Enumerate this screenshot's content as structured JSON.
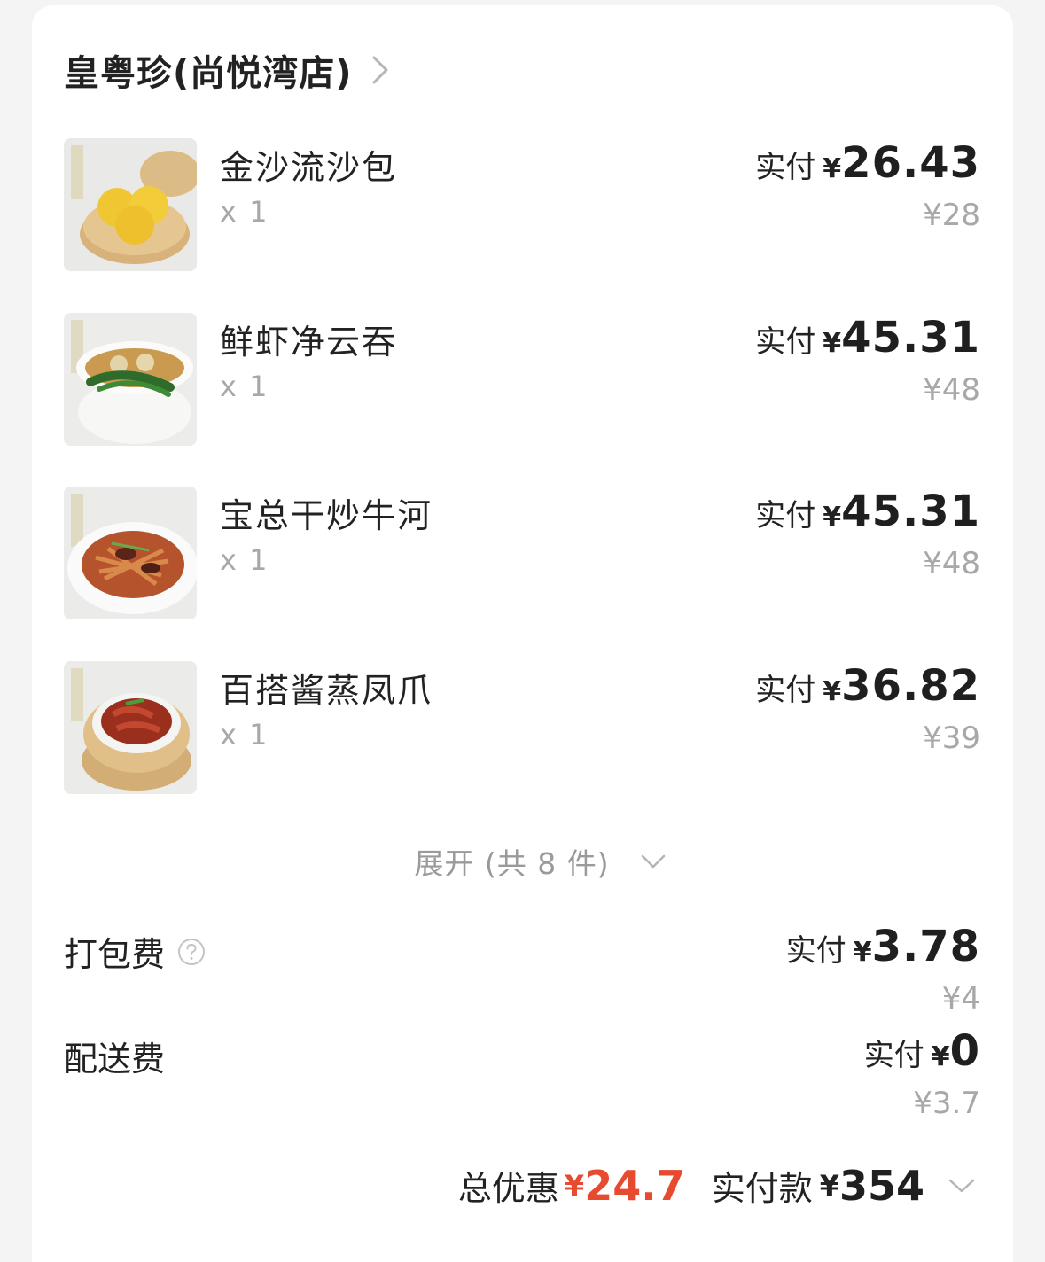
{
  "store": {
    "name": "皇粤珍(尚悦湾店)"
  },
  "items": [
    {
      "name": "金沙流沙包",
      "qty": "x 1",
      "paid_label": "实付",
      "currency": "¥",
      "paid": "26.43",
      "original": "¥28",
      "image": "steamed-custard-buns"
    },
    {
      "name": "鲜虾净云吞",
      "qty": "x 1",
      "paid_label": "实付",
      "currency": "¥",
      "paid": "45.31",
      "original": "¥48",
      "image": "shrimp-wonton-soup"
    },
    {
      "name": "宝总干炒牛河",
      "qty": "x 1",
      "paid_label": "实付",
      "currency": "¥",
      "paid": "45.31",
      "original": "¥48",
      "image": "beef-chow-fun"
    },
    {
      "name": "百搭酱蒸凤爪",
      "qty": "x 1",
      "paid_label": "实付",
      "currency": "¥",
      "paid": "36.82",
      "original": "¥39",
      "image": "steamed-chicken-feet"
    }
  ],
  "expand": {
    "label": "展开 (共 8 件)"
  },
  "fees": {
    "packaging": {
      "label": "打包费",
      "paid_label": "实付",
      "currency": "¥",
      "paid": "3.78",
      "original": "¥4"
    },
    "delivery": {
      "label": "配送费",
      "paid_label": "实付",
      "currency": "¥",
      "paid": "0",
      "original": "¥3.7"
    }
  },
  "summary": {
    "discount_label": "总优惠",
    "discount_currency": "¥",
    "discount": "24.7",
    "total_label": "实付款",
    "total_currency": "¥",
    "total": "354"
  },
  "colors": {
    "accent_red": "#e84a2f",
    "muted": "#a8a8a8",
    "background": "#f4f4f4",
    "card": "#ffffff"
  }
}
